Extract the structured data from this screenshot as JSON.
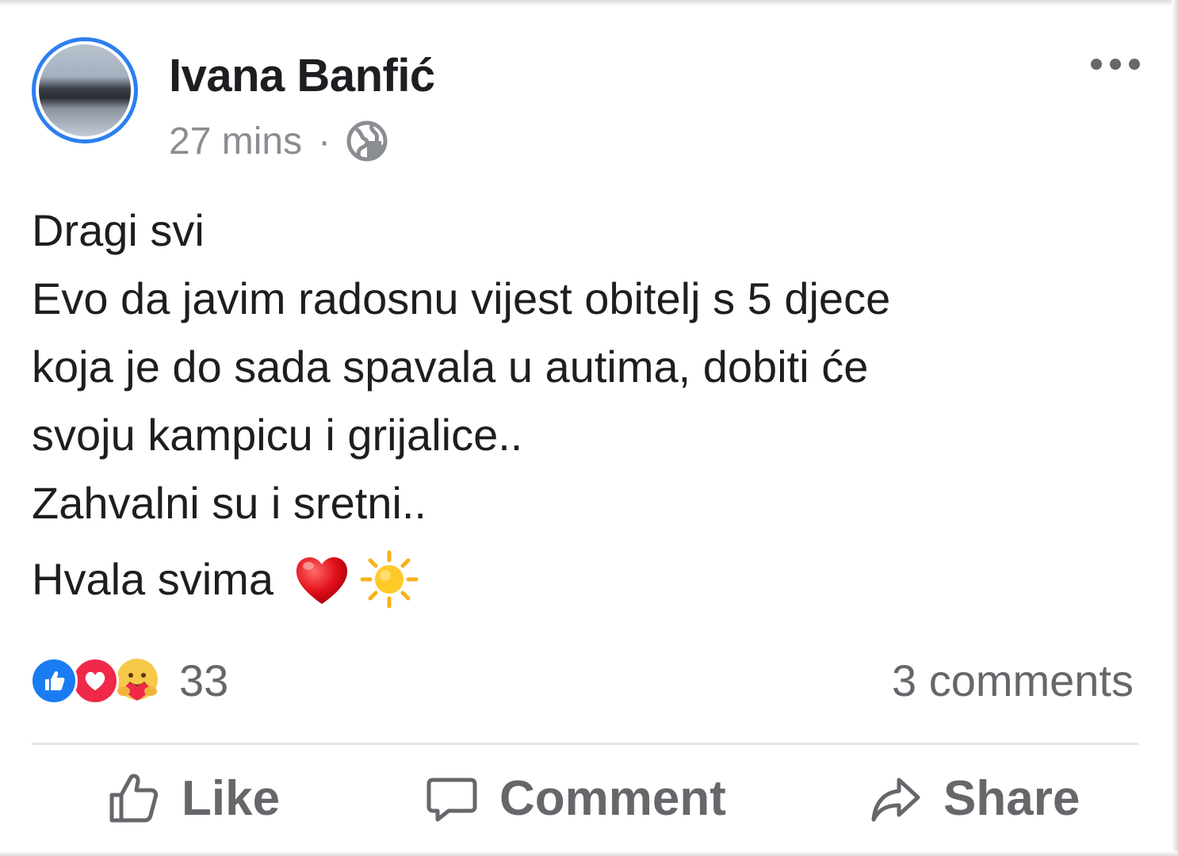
{
  "post": {
    "author": "Ivana Banfić",
    "time": "27 mins",
    "separator": "·",
    "privacy_icon": "globe-icon",
    "more_icon": "more-options-icon",
    "lines": [
      "Dragi svi",
      "Evo da javim radosnu vijest obitelj s 5 djece",
      "koja je do sada spavala u autima, dobiti će",
      "svoju kampicu i grijalice..",
      "Zahvalni su i sretni.."
    ],
    "last_line": "Hvala svima",
    "last_line_emojis": [
      "red-heart",
      "sun"
    ]
  },
  "reactions": {
    "types": [
      "like",
      "love",
      "care"
    ],
    "count": "33"
  },
  "comments": {
    "label": "3 comments"
  },
  "actions": {
    "like": "Like",
    "comment": "Comment",
    "share": "Share"
  },
  "colors": {
    "avatar_ring": "#2d7ff0",
    "like_reaction": "#1a7cf2",
    "love_reaction": "#f02849",
    "muted_text": "#65676b"
  }
}
